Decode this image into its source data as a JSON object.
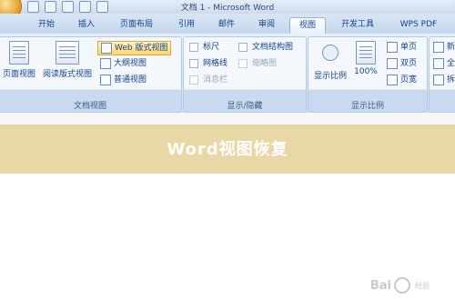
{
  "window": {
    "title": "文档 1 - Microsoft Word"
  },
  "tabs": [
    {
      "label": "开始"
    },
    {
      "label": "插入"
    },
    {
      "label": "页面布局"
    },
    {
      "label": "引用"
    },
    {
      "label": "邮件"
    },
    {
      "label": "审阅"
    },
    {
      "label": "视图",
      "active": true
    },
    {
      "label": "开发工具"
    },
    {
      "label": "WPS PDF"
    }
  ],
  "ribbon": {
    "doc_views": {
      "label": "文档视图",
      "page_view": "页面视图",
      "reading_view": "阅读版式视图",
      "web_view": "Web 版式视图",
      "outline_view": "大纲视图",
      "draft_view": "普通视图"
    },
    "show_hide": {
      "label": "显示/隐藏",
      "ruler": "标尺",
      "gridlines": "网格线",
      "message_bar": "消息栏",
      "doc_map": "文档结构图",
      "thumbnails": "缩略图"
    },
    "zoom": {
      "label": "显示比例",
      "zoom_button": "显示比例",
      "hundred": "100%",
      "one_page": "单页",
      "two_pages": "双页",
      "page_width": "页宽"
    },
    "window_partial": {
      "new": "新",
      "all": "全",
      "split": "拆"
    }
  },
  "banner": {
    "title": "Word视图恢复"
  },
  "watermark": {
    "brand": "Bai",
    "suffix": "经验"
  }
}
